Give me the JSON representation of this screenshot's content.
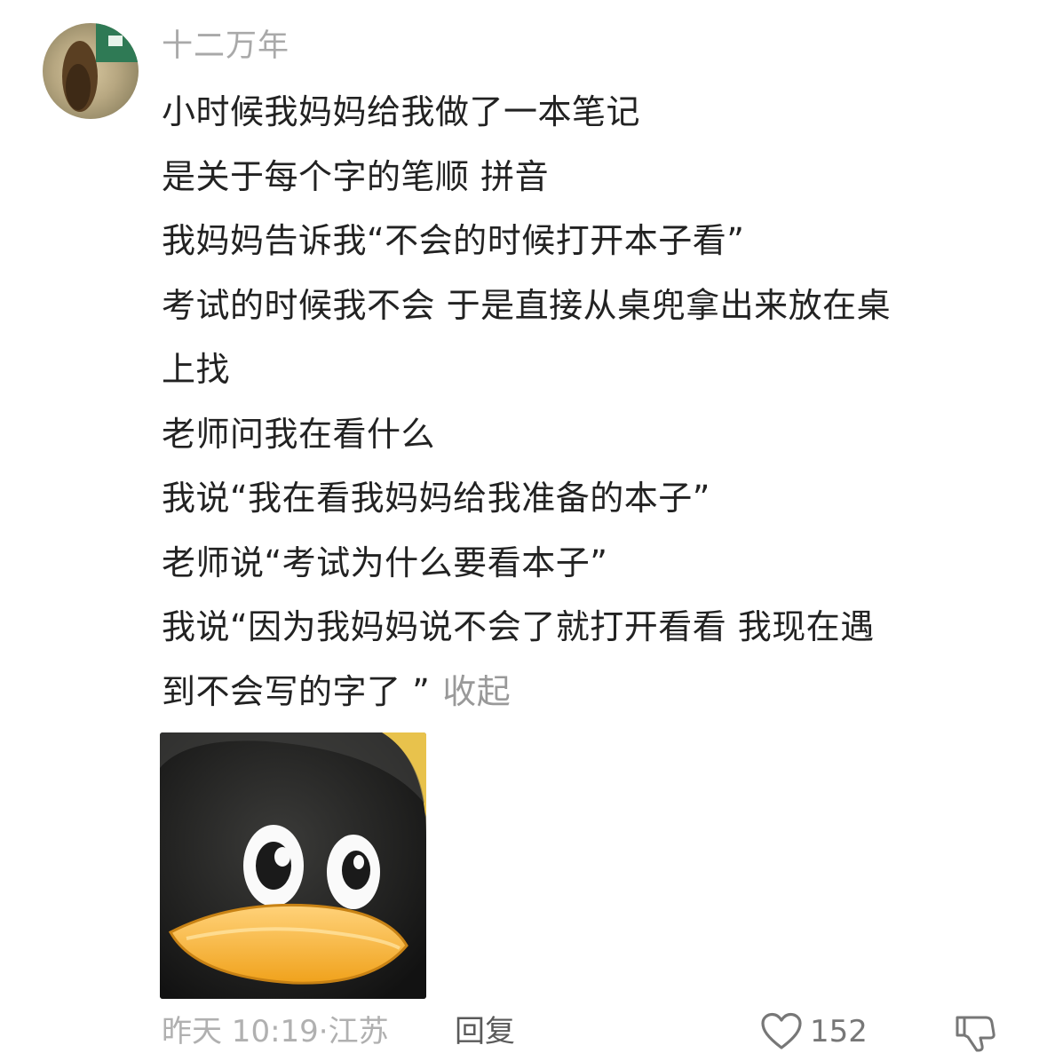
{
  "comment": {
    "username": "十二万年",
    "lines": [
      "小时候我妈妈给我做了一本笔记",
      "是关于每个字的笔顺 拼音",
      "我妈妈告诉我“不会的时候打开本子看”",
      "考试的时候我不会 于是直接从桌兜拿出来放在桌",
      "上找",
      "老师问我在看什么",
      "我说“我在看我妈妈给我准备的本子”",
      "老师说“考试为什么要看本子”",
      "我说“因为我妈妈说不会了就打开看看 我现在遇",
      "到不会写的字了 ”"
    ],
    "collapse_label": "收起",
    "sticker_icon": "qq-penguin-face-sticker",
    "timestamp": "昨天 10:19",
    "separator": "·",
    "location": "江苏",
    "reply_label": "回复",
    "like_count": "152",
    "like_icon": "heart-outline-icon",
    "dislike_icon": "thumbs-down-outline-icon"
  }
}
